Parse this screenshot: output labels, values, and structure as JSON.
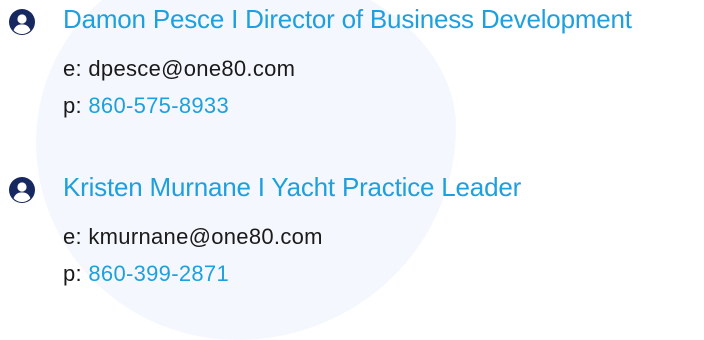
{
  "colors": {
    "accent": "#1ea0df",
    "text": "#1a1a1a",
    "icon": "#16285f",
    "background_shape": "#f4f7fd"
  },
  "contacts": [
    {
      "icon": "user-circle-icon",
      "name": "Damon Pesce I Director of Business Development",
      "email_label": "e:",
      "email": "dpesce@one80.com",
      "phone_label": "p:",
      "phone": "860-575-8933"
    },
    {
      "icon": "user-circle-icon",
      "name": "Kristen Murnane I Yacht Practice Leader",
      "email_label": "e:",
      "email": "kmurnane@one80.com",
      "phone_label": "p:",
      "phone": "860-399-2871"
    }
  ]
}
